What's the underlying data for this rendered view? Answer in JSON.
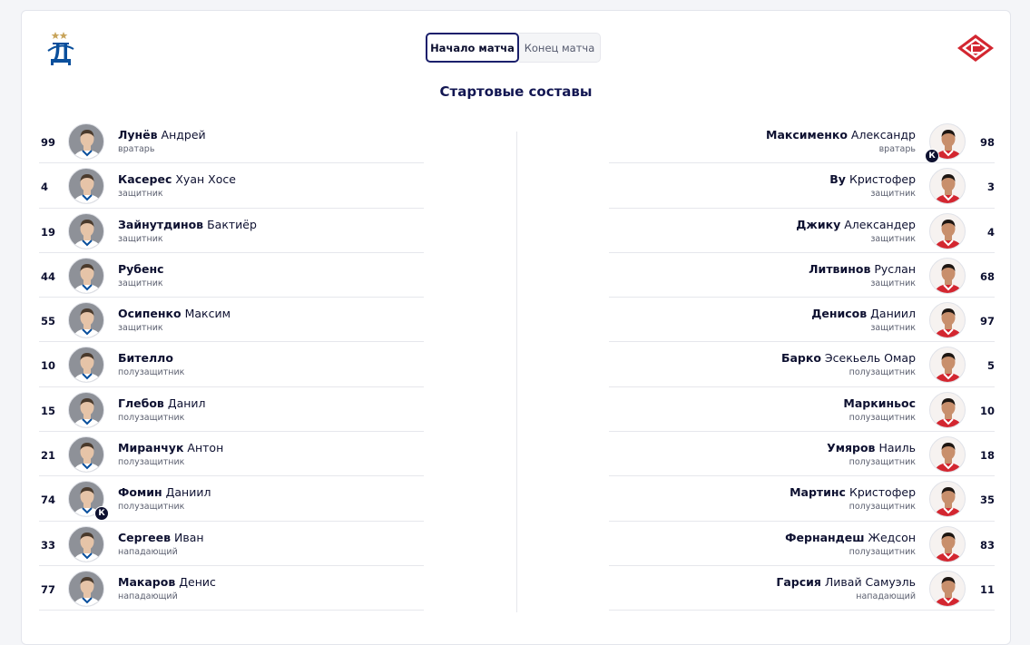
{
  "tabs": [
    {
      "label": "Начало матча",
      "active": true
    },
    {
      "label": "Конец матча",
      "active": false
    }
  ],
  "heading": "Стартовые составы",
  "captain_badge": "К",
  "colors": {
    "accent": "#1a1f6b",
    "dynamo": "#0a4f9c",
    "spartak": "#d32630"
  },
  "home": {
    "team_logo": "dynamo-logo",
    "players": [
      {
        "number": "99",
        "last": "Лунёв",
        "first": "Андрей",
        "position": "вратарь",
        "captain": false
      },
      {
        "number": "4",
        "last": "Касерес",
        "first": "Хуан Хосе",
        "position": "защитник",
        "captain": false
      },
      {
        "number": "19",
        "last": "Зайнутдинов",
        "first": "Бактиёр",
        "position": "защитник",
        "captain": false
      },
      {
        "number": "44",
        "last": "Рубенс",
        "first": "",
        "position": "защитник",
        "captain": false
      },
      {
        "number": "55",
        "last": "Осипенко",
        "first": "Максим",
        "position": "защитник",
        "captain": false
      },
      {
        "number": "10",
        "last": "Бителло",
        "first": "",
        "position": "полузащитник",
        "captain": false
      },
      {
        "number": "15",
        "last": "Глебов",
        "first": "Данил",
        "position": "полузащитник",
        "captain": false
      },
      {
        "number": "21",
        "last": "Миранчук",
        "first": "Антон",
        "position": "полузащитник",
        "captain": false
      },
      {
        "number": "74",
        "last": "Фомин",
        "first": "Даниил",
        "position": "полузащитник",
        "captain": true
      },
      {
        "number": "33",
        "last": "Сергеев",
        "first": "Иван",
        "position": "нападающий",
        "captain": false
      },
      {
        "number": "77",
        "last": "Макаров",
        "first": "Денис",
        "position": "нападающий",
        "captain": false
      }
    ]
  },
  "away": {
    "team_logo": "spartak-logo",
    "players": [
      {
        "number": "98",
        "last": "Максименко",
        "first": "Александр",
        "position": "вратарь",
        "captain": true
      },
      {
        "number": "3",
        "last": "Ву",
        "first": "Кристофер",
        "position": "защитник",
        "captain": false
      },
      {
        "number": "4",
        "last": "Джику",
        "first": "Александер",
        "position": "защитник",
        "captain": false
      },
      {
        "number": "68",
        "last": "Литвинов",
        "first": "Руслан",
        "position": "защитник",
        "captain": false
      },
      {
        "number": "97",
        "last": "Денисов",
        "first": "Даниил",
        "position": "защитник",
        "captain": false
      },
      {
        "number": "5",
        "last": "Барко",
        "first": "Эсекьель Омар",
        "position": "полузащитник",
        "captain": false
      },
      {
        "number": "10",
        "last": "Маркиньос",
        "first": "",
        "position": "полузащитник",
        "captain": false
      },
      {
        "number": "18",
        "last": "Умяров",
        "first": "Наиль",
        "position": "полузащитник",
        "captain": false
      },
      {
        "number": "35",
        "last": "Мартинс",
        "first": "Кристофер",
        "position": "полузащитник",
        "captain": false
      },
      {
        "number": "83",
        "last": "Фернандеш",
        "first": "Жедсон",
        "position": "полузащитник",
        "captain": false
      },
      {
        "number": "11",
        "last": "Гарсия",
        "first": "Ливай Самуэль",
        "position": "нападающий",
        "captain": false
      }
    ]
  }
}
